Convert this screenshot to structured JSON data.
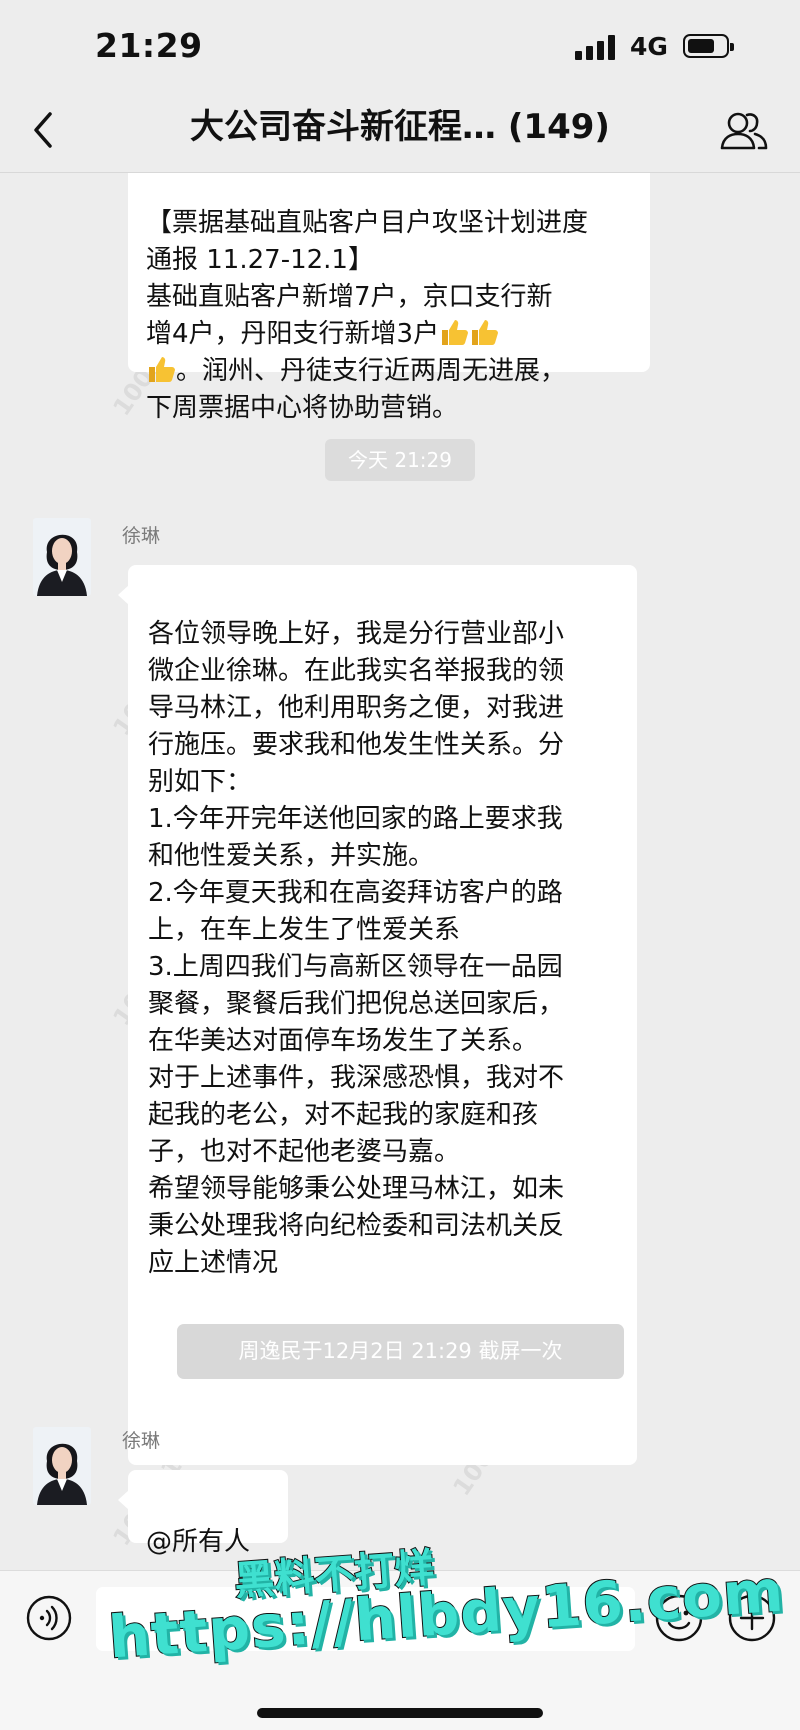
{
  "status_bar": {
    "time": "21:29",
    "network": "4G",
    "battery_level": 0.72
  },
  "nav": {
    "back_icon": "chevron-left-icon",
    "title": "大公司奋斗新征程… (149)",
    "members_icon": "group-members-icon"
  },
  "messages": {
    "cut_off": {
      "text": "【票据基础直贴客户目户攻坚计划进度\n通报 11.27-12.1】\n基础直贴客户新增7户，京口支行新\n增4户，丹阳支行新增3户",
      "text_tail": "。润州、丹徒支行近两周无进展，\n下周票据中心将协助营销。",
      "emoji": "thumbs-up-icon"
    },
    "timestamp": "今天 21:29",
    "report": {
      "sender": "徐琳",
      "text": "各位领导晚上好，我是分行营业部小\n微企业徐琳。在此我实名举报我的领\n导马林江，他利用职务之便，对我进\n行施压。要求我和他发生性关系。分\n别如下：\n1.今年开完年送他回家的路上要求我\n和他性爱关系，并实施。\n2.今年夏天我和在高姿拜访客户的路\n上，在车上发生了性爱关系\n3.上周四我们与高新区领导在一品园\n聚餐，聚餐后我们把倪总送回家后，\n在华美达对面停车场发生了关系。\n对于上述事件，我深感恐惧，我对不\n起我的老公，对不起我的家庭和孩\n子，也对不起他老婆马嘉。\n希望领导能够秉公处理马林江，如未\n秉公处理我将向纪检委和司法机关反\n应上述情况"
    },
    "screenshot_notice": "周逸民于12月2日 21:29 截屏一次",
    "mention": {
      "sender": "徐琳",
      "text": "@所有人"
    }
  },
  "watermark": "1005013 董玦",
  "input_bar": {
    "voice_icon": "voice-icon",
    "emoji_icon": "smiley-icon",
    "plus_icon": "plus-circle-icon"
  },
  "overlay_ad": {
    "line1": "黑料不打烊",
    "line2": "https://hlbdy16.com"
  }
}
